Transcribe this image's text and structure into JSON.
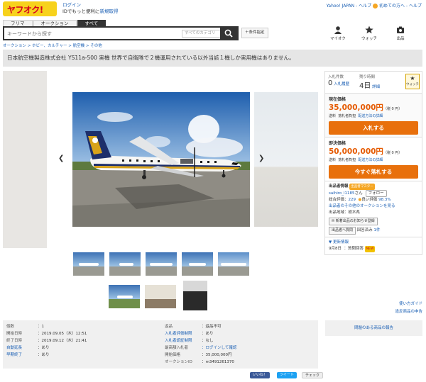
{
  "header": {
    "logo": "ヤフオク!",
    "login_link": "ログイン",
    "login_sub": "IDでもっと便利に",
    "register_link": "新規取得",
    "yahoo_top": "Yahoo! JAPAN",
    "help": "ヘルプ",
    "beginner": "初めての方へ",
    "menu": "ヘルプ"
  },
  "tabs": [
    "フリマ",
    "オークション",
    "すべて"
  ],
  "search": {
    "placeholder": "キーワードから探す",
    "category": "すべてのカテゴリ",
    "conditions": "＋条件指定"
  },
  "icons": [
    {
      "name": "my-auction-icon",
      "label": "マイオク"
    },
    {
      "name": "watch-list-icon",
      "label": "ウォッチ"
    },
    {
      "name": "sell-icon",
      "label": "出品"
    }
  ],
  "breadcrumb": "オークション > ホビー、カルチャー > 航空機 > その他",
  "title": "日本航空機製造株式会社  YS11a-500  実機  世界で自衛隊で２機運用されている以外当該１機しか実用機はありません。",
  "stats": {
    "bids_label": "入札件数",
    "bids": "0",
    "bids_link": "入札履歴",
    "time_label": "残り時間",
    "time": "4日",
    "time_link": "詳細",
    "watch_label": "ウォッチ"
  },
  "current": {
    "label": "現在価格",
    "price": "35,000,000円",
    "tax": "（税 0 円）",
    "shipping_label": "送料",
    "shipping_value": "落札者負担",
    "shipping_link": "配送方法の詳細",
    "bid_button": "入札する"
  },
  "buynow": {
    "label": "即決価格",
    "price": "50,000,000円",
    "tax": "（税 0 円）",
    "shipping_label": "送料",
    "shipping_value": "落札者負担",
    "shipping_link": "配送方法の詳細",
    "buy_button": "今すぐ落札する"
  },
  "seller": {
    "title": "出品者情報",
    "badge": "出品者マスター",
    "name": "saihiro_l1185",
    "suffix": "さん",
    "follow": "フォロー",
    "total_label": "総合評価：",
    "total": "229",
    "good_label": "良い評価",
    "good": "98.3%",
    "other_link": "出品者のその他のオークションを見る",
    "area": "出品地域：栃木県",
    "notify_button": "新着出品のお知らせ登録",
    "ask_button": "出品者へ質問",
    "answered_label": "回答済み",
    "answered": "1件"
  },
  "history": {
    "title": "更新情報",
    "date": "9月8日",
    "entry": "：質問回答",
    "new_badge": "NEW"
  },
  "help_links": [
    "使い方ガイド",
    "違反商品の申告"
  ],
  "report": "問題のある商品の報告",
  "info_left": [
    {
      "k": "個数",
      "v": "：1"
    },
    {
      "k": "開始日時",
      "v": "：2019.09.05（木）12:51"
    },
    {
      "k": "終了日時",
      "v": "：2019.09.12（木）21:41"
    },
    {
      "k": "自動延長",
      "v": "：あり"
    },
    {
      "k": "早期終了",
      "v": "：あり"
    }
  ],
  "info_right": [
    {
      "k": "返品",
      "v": "：返品不可"
    },
    {
      "k": "入札者評価制限",
      "v": "：あり"
    },
    {
      "k": "入札者認証制限",
      "v": "：なし"
    },
    {
      "k": "最高額入札者",
      "v": "：ログインして確認"
    },
    {
      "k": "開始価格",
      "v": "：35,000,000円"
    },
    {
      "k": "オークションID",
      "v": "：m3491261370"
    }
  ],
  "social": [
    "いいね！",
    "ツイート",
    "チェック"
  ],
  "colors": {
    "accent": "#e8700c",
    "link": "#1a5fb4",
    "logo": "#f7d21c"
  }
}
